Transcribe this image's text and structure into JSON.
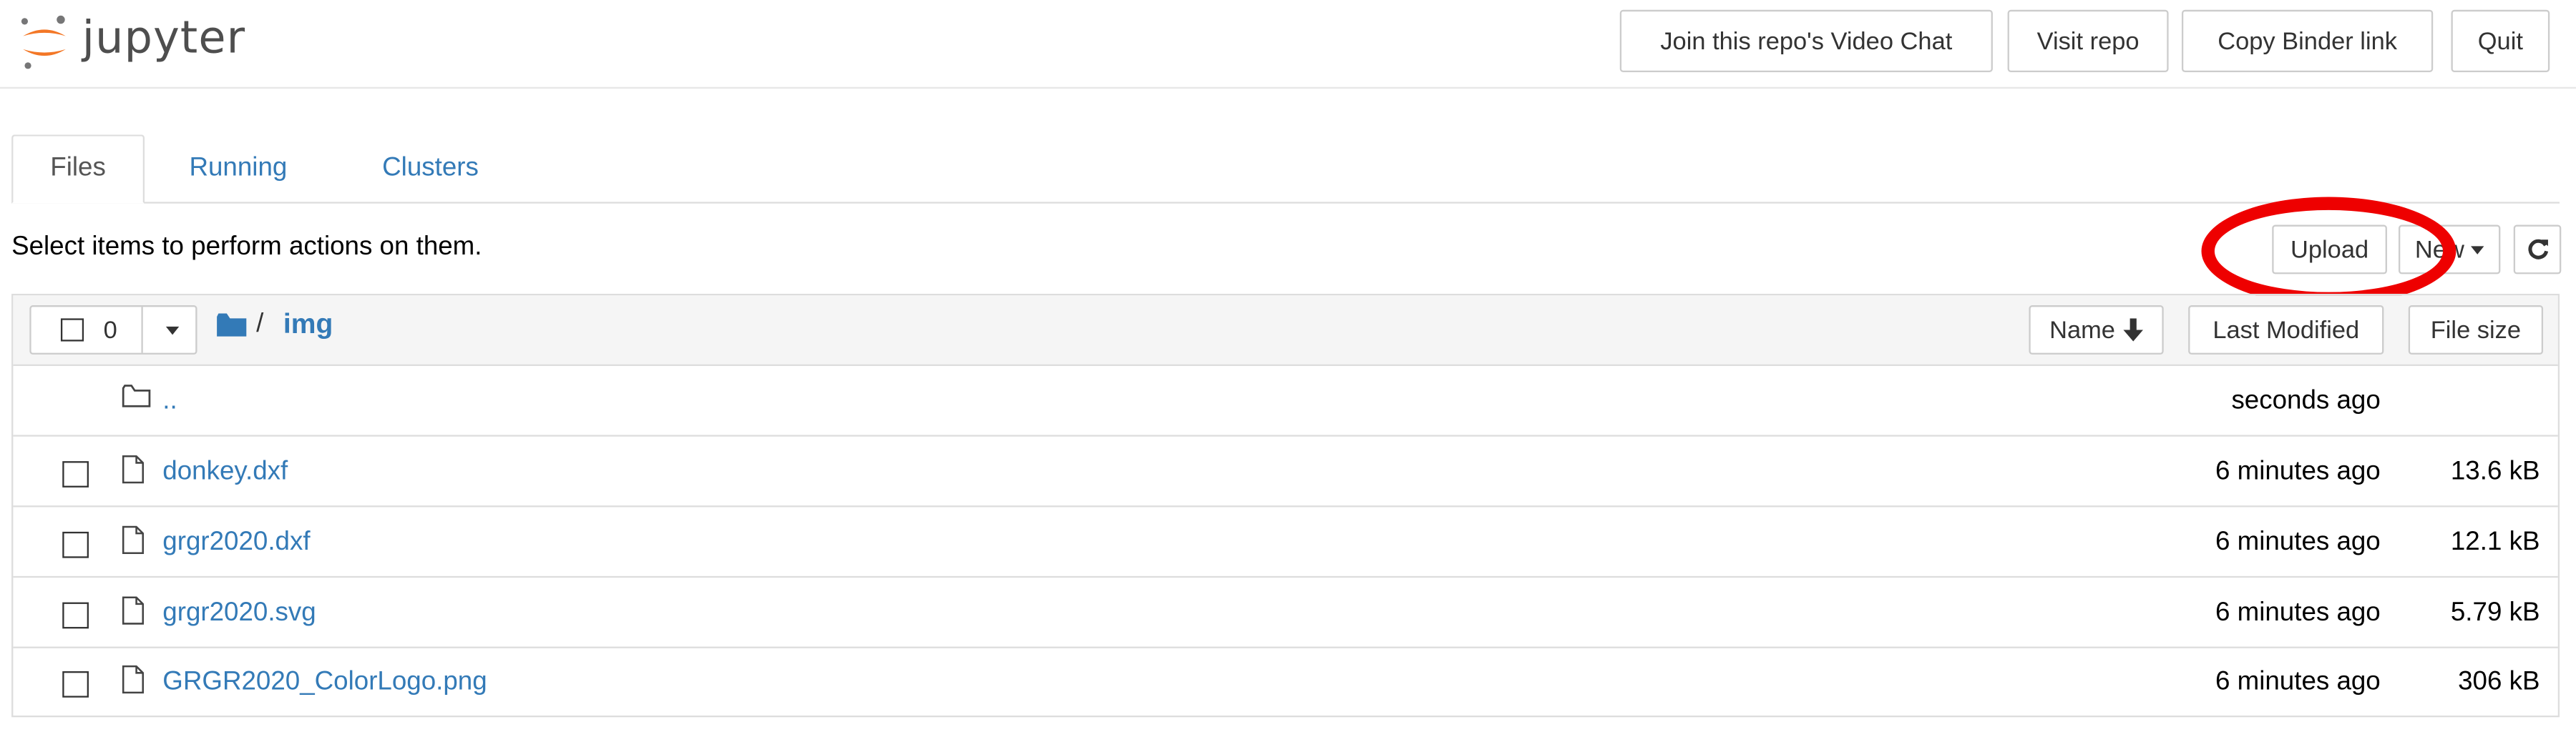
{
  "header": {
    "logo_text": "jupyter",
    "buttons": [
      "Join this repo's Video Chat",
      "Visit repo",
      "Copy Binder link",
      "Quit"
    ]
  },
  "tabs": [
    "Files",
    "Running",
    "Clusters"
  ],
  "hint": "Select items to perform actions on them.",
  "toolbar": {
    "upload": "Upload",
    "new": "New",
    "refresh_icon": "refresh-icon"
  },
  "list": {
    "selected_count": "0",
    "path_sep": "/",
    "current_dir": "img",
    "sort": {
      "name": "Name",
      "last_modified": "Last Modified",
      "file_size": "File size"
    },
    "rows": [
      {
        "name": "..",
        "modified": "seconds ago",
        "size": "",
        "type": "folder"
      },
      {
        "name": "donkey.dxf",
        "modified": "6 minutes ago",
        "size": "13.6 kB",
        "type": "file"
      },
      {
        "name": "grgr2020.dxf",
        "modified": "6 minutes ago",
        "size": "12.1 kB",
        "type": "file"
      },
      {
        "name": "grgr2020.svg",
        "modified": "6 minutes ago",
        "size": "5.79 kB",
        "type": "file"
      },
      {
        "name": "GRGR2020_ColorLogo.png",
        "modified": "6 minutes ago",
        "size": "306 kB",
        "type": "file"
      }
    ]
  },
  "colors": {
    "link": "#337ab7",
    "annotation": "#ee0000",
    "logo_orange": "#f37726"
  }
}
